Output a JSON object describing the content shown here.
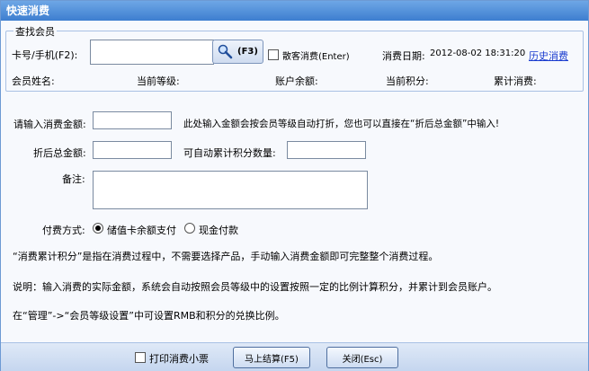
{
  "window": {
    "title": "快速消费"
  },
  "member_search": {
    "group_label": "查找会员",
    "card_label": "卡号/手机(F2):",
    "card_value": "",
    "search_button_label": "(F3)",
    "walkin_label": "散客消费(Enter)",
    "date_label": "消费日期:",
    "date_value": "2012-08-02 18:31:20",
    "history_link": "历史消费",
    "member_name_label": "会员姓名:",
    "level_label": "当前等级:",
    "balance_label": "账户余额:",
    "points_label": "当前积分:",
    "cumulative_label": "累计消费:"
  },
  "form": {
    "amount_label": "请输入消费金额:",
    "amount_value": "",
    "amount_hint": "此处输入金额会按会员等级自动打折，您也可以直接在“折后总金额”中输入!",
    "discount_total_label": "折后总金额:",
    "discount_total_value": "",
    "auto_points_label": "可自动累计积分数量:",
    "auto_points_value": "",
    "remark_label": "备注:",
    "remark_value": "",
    "payment_label": "付费方式:",
    "payment_options": [
      "储值卡余额支付",
      "现金付款"
    ],
    "payment_selected": "储值卡余额支付"
  },
  "notes": {
    "note1": "“消费累计积分”是指在消费过程中，不需要选择产品，手动输入消费金额即可完整整个消费过程。",
    "note2": "说明：输入消费的实际金额，系统会自动按照会员等级中的设置按照一定的比例计算积分，并累计到会员账户。",
    "note3": "在“管理”->“会员等级设置”中可设置RMB和积分的兑换比例。"
  },
  "footer": {
    "print_label": "打印消费小票",
    "print_checked": false,
    "settle_button": "马上结算(F5)",
    "close_button": "关闭(Esc)"
  },
  "icons": {
    "search": "search-key-icon"
  }
}
